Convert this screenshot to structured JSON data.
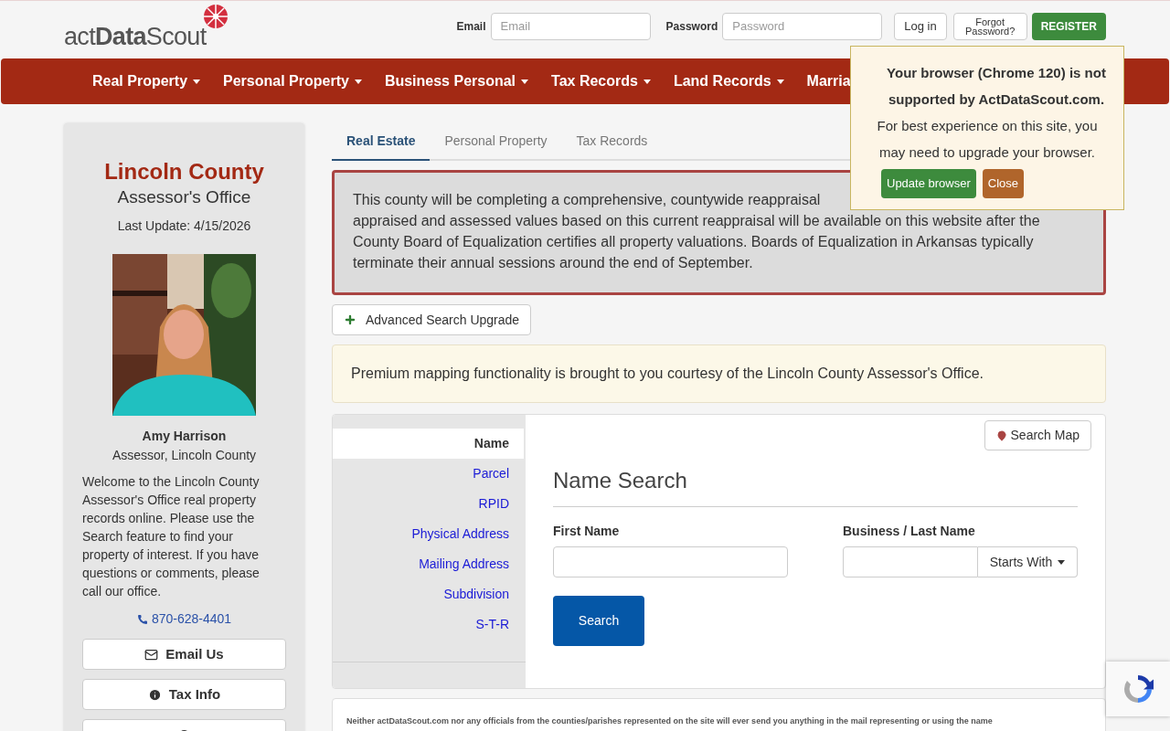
{
  "header": {
    "logo": "act**Data**Scout",
    "email_label": "Email",
    "email_placeholder": "Email",
    "password_label": "Password",
    "password_placeholder": "Password",
    "login": "Log in",
    "forgot": "Forgot Password?",
    "register": "REGISTER"
  },
  "nav": [
    {
      "label": "Real Property",
      "caret": true
    },
    {
      "label": "Personal Property",
      "caret": true
    },
    {
      "label": "Business Personal",
      "caret": true
    },
    {
      "label": "Tax Records",
      "caret": true
    },
    {
      "label": "Land Records",
      "caret": true
    },
    {
      "label": "Marria",
      "caret": false
    }
  ],
  "popup": {
    "title": "Your browser (Chrome 120) is not supported by ActDataScout.com.",
    "text": "For best experience on this site, you may need to upgrade your browser.",
    "update": "Update browser",
    "close": "Close"
  },
  "sidebar": {
    "county": "Lincoln County",
    "office": "Assessor's Office",
    "last_update": "Last Update: 4/15/2026",
    "name": "Amy Harrison",
    "role": "Assessor, Lincoln County",
    "welcome": "Welcome to the Lincoln County Assessor's Office real property records online. Please use the Search feature to find your property of interest. If you have questions or comments, please call our office.",
    "phone": "870-628-4401",
    "buttons": [
      {
        "kind": "email",
        "label": "Email Us"
      },
      {
        "kind": "info",
        "label": "Tax Info"
      },
      {
        "kind": "info"
      }
    ]
  },
  "tabs": [
    {
      "label": "Real Estate",
      "selected": true
    },
    {
      "label": "Personal Property",
      "selected": false
    },
    {
      "label": "Tax Records",
      "selected": false
    }
  ],
  "notice_lines": [
    "This county will be completing a comprehensive, countywide reappraisal",
    "appraised and assessed values based on this current reappraisal will be available on this website after the",
    "County Board of Equalization certifies all property valuations. Boards of Equalization in Arkansas typically",
    "terminate their annual sessions around the end of September."
  ],
  "advanced": "Advanced Search Upgrade",
  "premium": "Premium mapping functionality is brought to you courtesy of the Lincoln County Assessor's Office.",
  "search_types": [
    {
      "label": "Name",
      "selected": true
    },
    {
      "label": "Parcel",
      "selected": false
    },
    {
      "label": "RPID",
      "selected": false
    },
    {
      "label": "Physical Address",
      "selected": false
    },
    {
      "label": "Mailing Address",
      "selected": false
    },
    {
      "label": "Subdivision",
      "selected": false
    },
    {
      "label": "S-T-R",
      "selected": false
    }
  ],
  "search_map": "Search Map",
  "form": {
    "title": "Name Search",
    "first_label": "First Name",
    "last_label": "Business / Last Name",
    "match": "Starts With",
    "submit": "Search"
  },
  "footer": "Neither actDataScout.com nor any officials from the counties/parishes represented on the site will ever send you anything in the mail representing or using the name"
}
